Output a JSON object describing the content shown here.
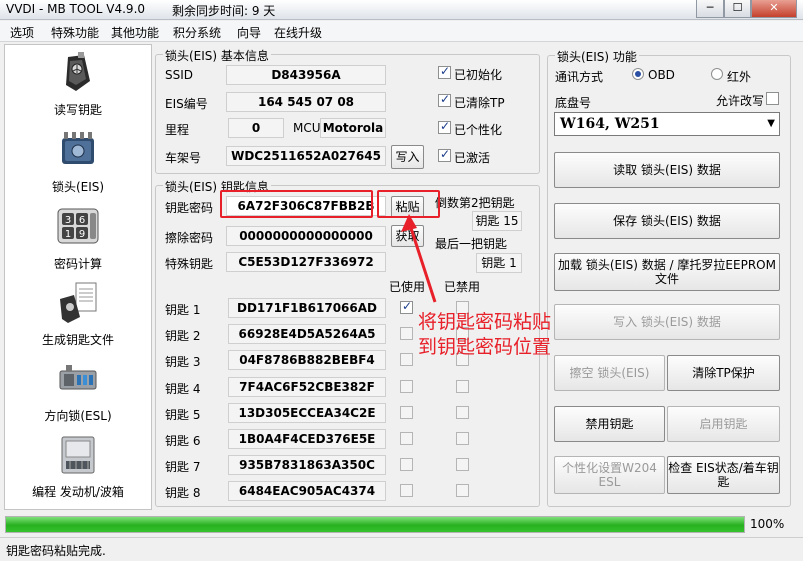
{
  "window": {
    "title": "VVDI - MB TOOL V4.9.0",
    "sync": "剩余同步时间: 9 天",
    "min": "─",
    "max": "☐",
    "close": "✕"
  },
  "menu": [
    "选项",
    "特殊功能",
    "其他功能",
    "积分系统",
    "向导",
    "在线升级"
  ],
  "nav": [
    {
      "label": "读写钥匙",
      "icon": "car-key-icon"
    },
    {
      "label": "锁头(EIS)",
      "icon": "eis-module-icon"
    },
    {
      "label": "密码计算",
      "icon": "password-calc-icon"
    },
    {
      "label": "生成钥匙文件",
      "icon": "key-file-icon"
    },
    {
      "label": "方向锁(ESL)",
      "icon": "esl-lock-icon"
    },
    {
      "label": "编程 发动机/波箱",
      "icon": "ecu-module-icon"
    }
  ],
  "eis_info": {
    "title": "锁头(EIS) 基本信息",
    "ssid_label": "SSID",
    "ssid": "D843956A",
    "eis_label": "EIS编号",
    "eis": "164 545 07 08",
    "mileage_label": "里程",
    "mileage": "0",
    "mcu_label": "MCU",
    "mcu": "Motorola",
    "vin_label": "车架号",
    "vin": "WDC2511652A027645",
    "write_btn": "写入",
    "initialized": "已初始化",
    "tp_cleared": "已清除TP",
    "personalized": "已个性化",
    "activated": "已激活"
  },
  "key_info": {
    "title": "锁头(EIS) 钥匙信息",
    "key_pw_label": "钥匙密码",
    "key_pw": "6A72F306C87FBB2B",
    "paste_btn": "粘贴",
    "erase_pw_label": "擦除密码",
    "erase_pw": "0000000000000000",
    "get_btn": "获取",
    "special_label": "特殊钥匙",
    "special": "C5E53D127F336972",
    "last2_label": "倒数第2把钥匙",
    "last2": "钥匙 15",
    "last_label": "最后一把钥匙",
    "last": "钥匙 1",
    "used_header": "已使用",
    "disabled_header": "已禁用",
    "keys": [
      {
        "label": "钥匙 1",
        "value": "DD171F1B617066AD"
      },
      {
        "label": "钥匙 2",
        "value": "66928E4D5A5264A5"
      },
      {
        "label": "钥匙 3",
        "value": "04F8786B882BEBF4"
      },
      {
        "label": "钥匙 4",
        "value": "7F4AC6F52CBE382F"
      },
      {
        "label": "钥匙 5",
        "value": "13D305ECCEA34C2E"
      },
      {
        "label": "钥匙 6",
        "value": "1B0A4F4CED376E5E"
      },
      {
        "label": "钥匙 7",
        "value": "935B7831863A350C"
      },
      {
        "label": "钥匙 8",
        "value": "6484EAC905AC4374"
      }
    ]
  },
  "eis_func": {
    "title": "锁头(EIS) 功能",
    "comm_label": "通讯方式",
    "obd": "OBD",
    "ir": "红外",
    "chassis_label": "底盘号",
    "allow_label": "允许改写",
    "chassis": "W164, W251",
    "read_btn": "读取 锁头(EIS) 数据",
    "save_btn": "保存 锁头(EIS) 数据",
    "load_btn_1": "加载 锁头(EIS) 数据 / 摩托罗拉EEPROM",
    "load_btn_2": "文件",
    "write_btn": "写入 锁头(EIS) 数据",
    "erase_btn": "擦空 锁头(EIS)",
    "clear_tp_btn": "清除TP保护",
    "disable_key_btn": "禁用钥匙",
    "enable_key_btn": "启用钥匙",
    "personalize_btn_1": "个性化设置W204",
    "personalize_btn_2": "ESL",
    "check_btn_1": "检查 EIS状态/着车钥",
    "check_btn_2": "匙"
  },
  "annotation": {
    "line1": "将钥匙密码粘贴",
    "line2": "到钥匙密码位置"
  },
  "progress": {
    "value": 1.0,
    "label": "100%"
  },
  "status": "钥匙密码粘贴完成.",
  "colors": {
    "accent_red": "#e8202a",
    "progress_green": "#27b01f"
  }
}
